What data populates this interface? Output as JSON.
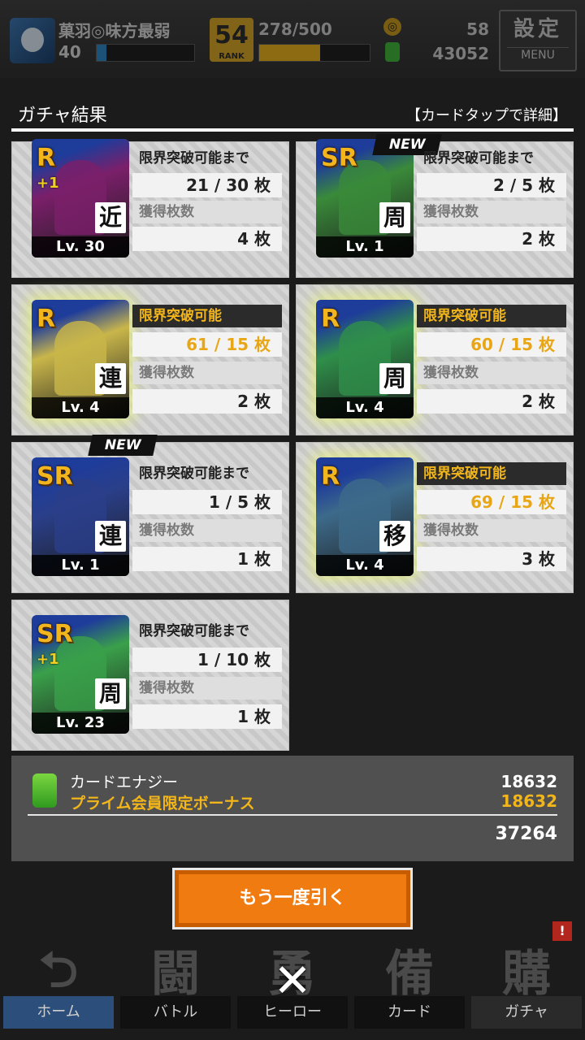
{
  "topbar": {
    "player_name": "菓羽◎味方最弱",
    "player_level": "40",
    "level_progress": 0.1,
    "rank_number": "54",
    "rank_label": "RANK",
    "rank_count": "278/500",
    "rank_progress": 0.55,
    "coins": "58",
    "energy": "43052",
    "settings_label": "設定",
    "menu_label": "MENU"
  },
  "panel": {
    "title": "ガチャ結果",
    "hint": "【カードタップで詳細】"
  },
  "cards": [
    {
      "rarity": "R",
      "plus": "+1",
      "type": "近",
      "level": "Lv. 30",
      "status": "限界突破可能まで",
      "progress": "21 / 30 枚",
      "acquired_label": "獲得枚数",
      "acquired": "4 枚",
      "new": "",
      "glow": false,
      "color": "#7b1f6a"
    },
    {
      "rarity": "SR",
      "plus": "",
      "type": "周",
      "level": "Lv. 1",
      "status": "限界突破可能まで",
      "progress": "2 / 5 枚",
      "acquired_label": "獲得枚数",
      "acquired": "2 枚",
      "new": "NEW",
      "glow": false,
      "color": "#3a8a3a"
    },
    {
      "rarity": "R",
      "plus": "",
      "type": "連",
      "level": "Lv. 4",
      "status": "限界突破可能",
      "progress": "61 / 15 枚",
      "acquired_label": "獲得枚数",
      "acquired": "2 枚",
      "new": "",
      "glow": true,
      "color": "#c9b64a"
    },
    {
      "rarity": "R",
      "plus": "",
      "type": "周",
      "level": "Lv. 4",
      "status": "限界突破可能",
      "progress": "60 / 15 枚",
      "acquired_label": "獲得枚数",
      "acquired": "2 枚",
      "new": "",
      "glow": true,
      "color": "#2f8f4a"
    },
    {
      "rarity": "SR",
      "plus": "",
      "type": "連",
      "level": "Lv. 1",
      "status": "限界突破可能まで",
      "progress": "1 / 5 枚",
      "acquired_label": "獲得枚数",
      "acquired": "1 枚",
      "new": "NEW",
      "glow": false,
      "color": "#2a3f8a"
    },
    {
      "rarity": "R",
      "plus": "",
      "type": "移",
      "level": "Lv. 4",
      "status": "限界突破可能",
      "progress": "69 / 15 枚",
      "acquired_label": "獲得枚数",
      "acquired": "3 枚",
      "new": "",
      "glow": true,
      "color": "#3d6a8a"
    },
    {
      "rarity": "SR",
      "plus": "+1",
      "type": "周",
      "level": "Lv. 23",
      "status": "限界突破可能まで",
      "progress": "1 / 10 枚",
      "acquired_label": "獲得枚数",
      "acquired": "1 枚",
      "new": "",
      "glow": false,
      "color": "#3aa04a"
    }
  ],
  "summary": {
    "energy_label": "カードエナジー",
    "energy_value": "18632",
    "bonus_label": "プライム会員限定ボーナス",
    "bonus_value": "18632",
    "total": "37264"
  },
  "again_button": "もう一度引く",
  "nav": [
    {
      "big": "⮌",
      "label": "ホーム"
    },
    {
      "big": "闘",
      "label": "バトル"
    },
    {
      "big": "勇",
      "label": "ヒーロー"
    },
    {
      "big": "備",
      "label": "カード"
    },
    {
      "big": "購",
      "label": "ガチャ"
    }
  ],
  "colors": {
    "accent": "#f07b10",
    "gold": "#f2b51a",
    "panel": "#505050"
  }
}
